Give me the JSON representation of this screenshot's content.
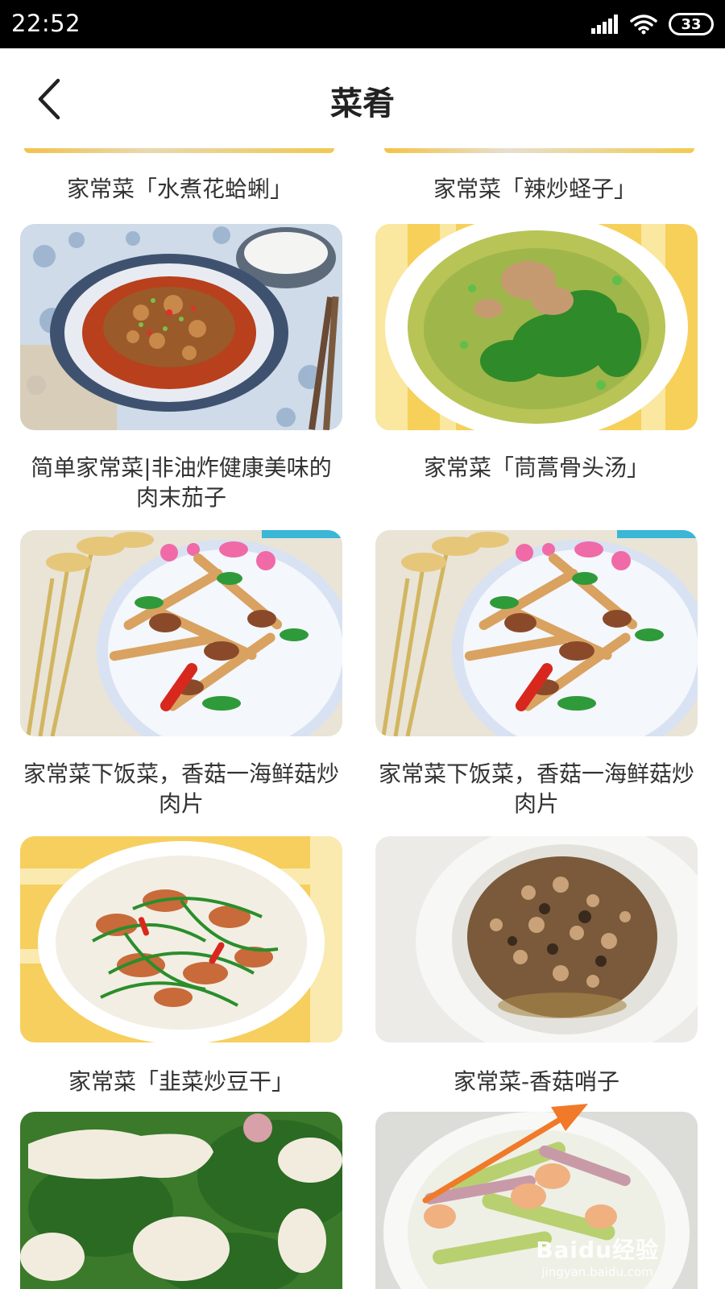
{
  "status_bar": {
    "time": "22:52",
    "battery_level": "33",
    "signal_icon": "signal-bars-icon",
    "wifi_icon": "wifi-icon"
  },
  "header": {
    "title": "菜肴",
    "back_icon": "chevron-left-icon"
  },
  "recipes": [
    {
      "title": "家常菜「水煮花蛤蜊」"
    },
    {
      "title": "家常菜「辣炒蛏子」"
    },
    {
      "title": "简单家常菜|非油炸健康美味的肉末茄子"
    },
    {
      "title": "家常菜「茼蒿骨头汤」"
    },
    {
      "title": "家常菜下饭菜，香菇一海鲜菇炒肉片"
    },
    {
      "title": "家常菜下饭菜，香菇一海鲜菇炒肉片"
    },
    {
      "title": "家常菜「韭菜炒豆干」"
    },
    {
      "title": "家常菜-香菇哨子"
    },
    {
      "title": ""
    },
    {
      "title": ""
    }
  ],
  "watermark": {
    "logo": "Baidu经验",
    "url": "jingyan.baidu.com"
  },
  "colors": {
    "status_bar_bg": "#000000",
    "annotation_arrow": "#f07a2a",
    "title_text": "#222222",
    "card_text": "#333333"
  }
}
